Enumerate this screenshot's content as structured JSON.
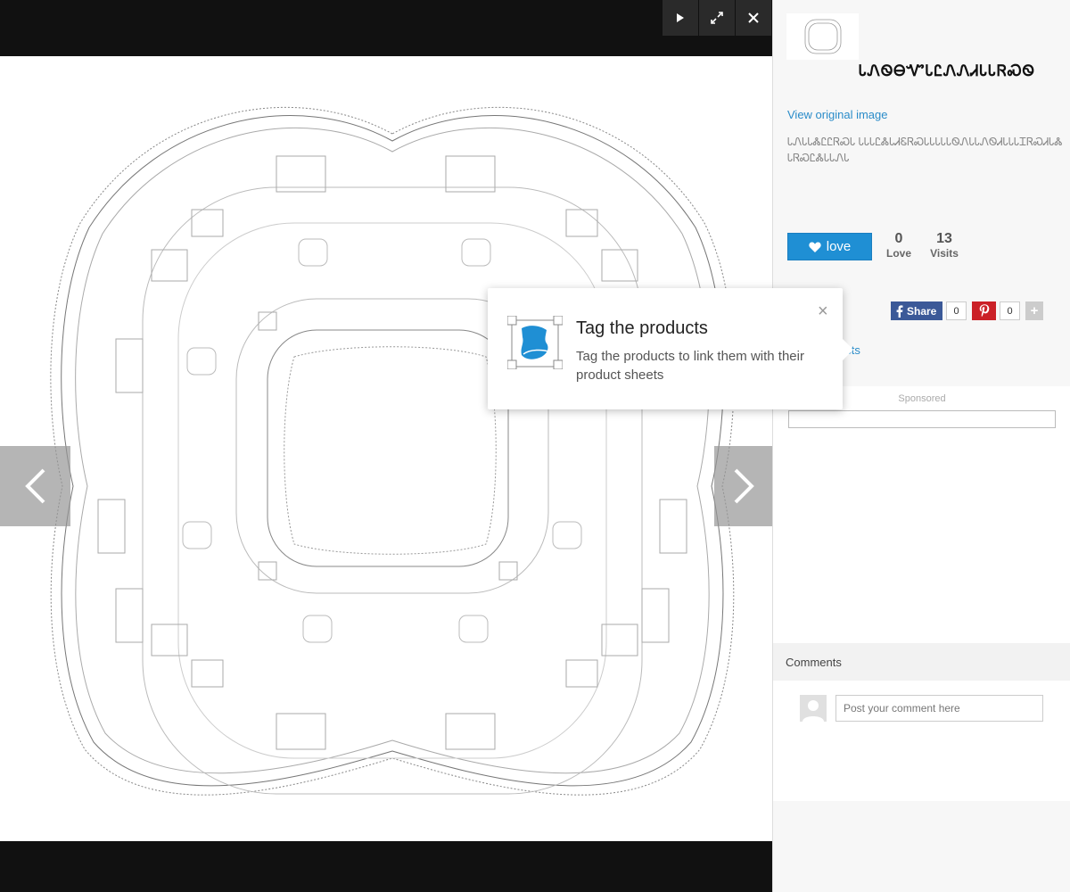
{
  "viewer": {
    "controls": {
      "play": "play-icon",
      "fullscreen": "expand-icon",
      "close": "close-icon"
    },
    "prev": "chevron-left-icon",
    "next": "chevron-right-icon"
  },
  "sidebar": {
    "title": "ᏓᏁᏫᎾᏉᏓᏝᏁᏁᏗᏓᏓᏒᏍᏫ",
    "view_original": "View original image",
    "description": "ᏓᏁᏓᏓᏜᏝᏝᏒᏍᏓ ᏓᏓᏓᏝᏜᏓᏗᏋᏒᏍᏓᏓᏓᏓᏓᏫᏁᏓᏓᏁᏫᏗᏓᏓᏓᏆᏒᏍᏗᏓᏜ ᏓᏒᏍᏝᏜᏓᏓᏁᏓ",
    "love_label": "love",
    "love_count": "0",
    "love_stat_label": "Love",
    "visits_count": "13",
    "visits_label": "Visits",
    "fb_share": "Share",
    "fb_count": "0",
    "pin_count": "0",
    "plus": "+",
    "tag_products": "ucts",
    "sponsored": "Sponsored",
    "comments_title": "Comments",
    "comment_placeholder": "Post your comment here"
  },
  "popover": {
    "title": "Tag the products",
    "text": "Tag the products to link them with their product sheets",
    "close": "×"
  },
  "colors": {
    "accent": "#1f8fd4",
    "link": "#2a8cc9",
    "facebook": "#3b5998",
    "pinterest": "#cb2027"
  }
}
